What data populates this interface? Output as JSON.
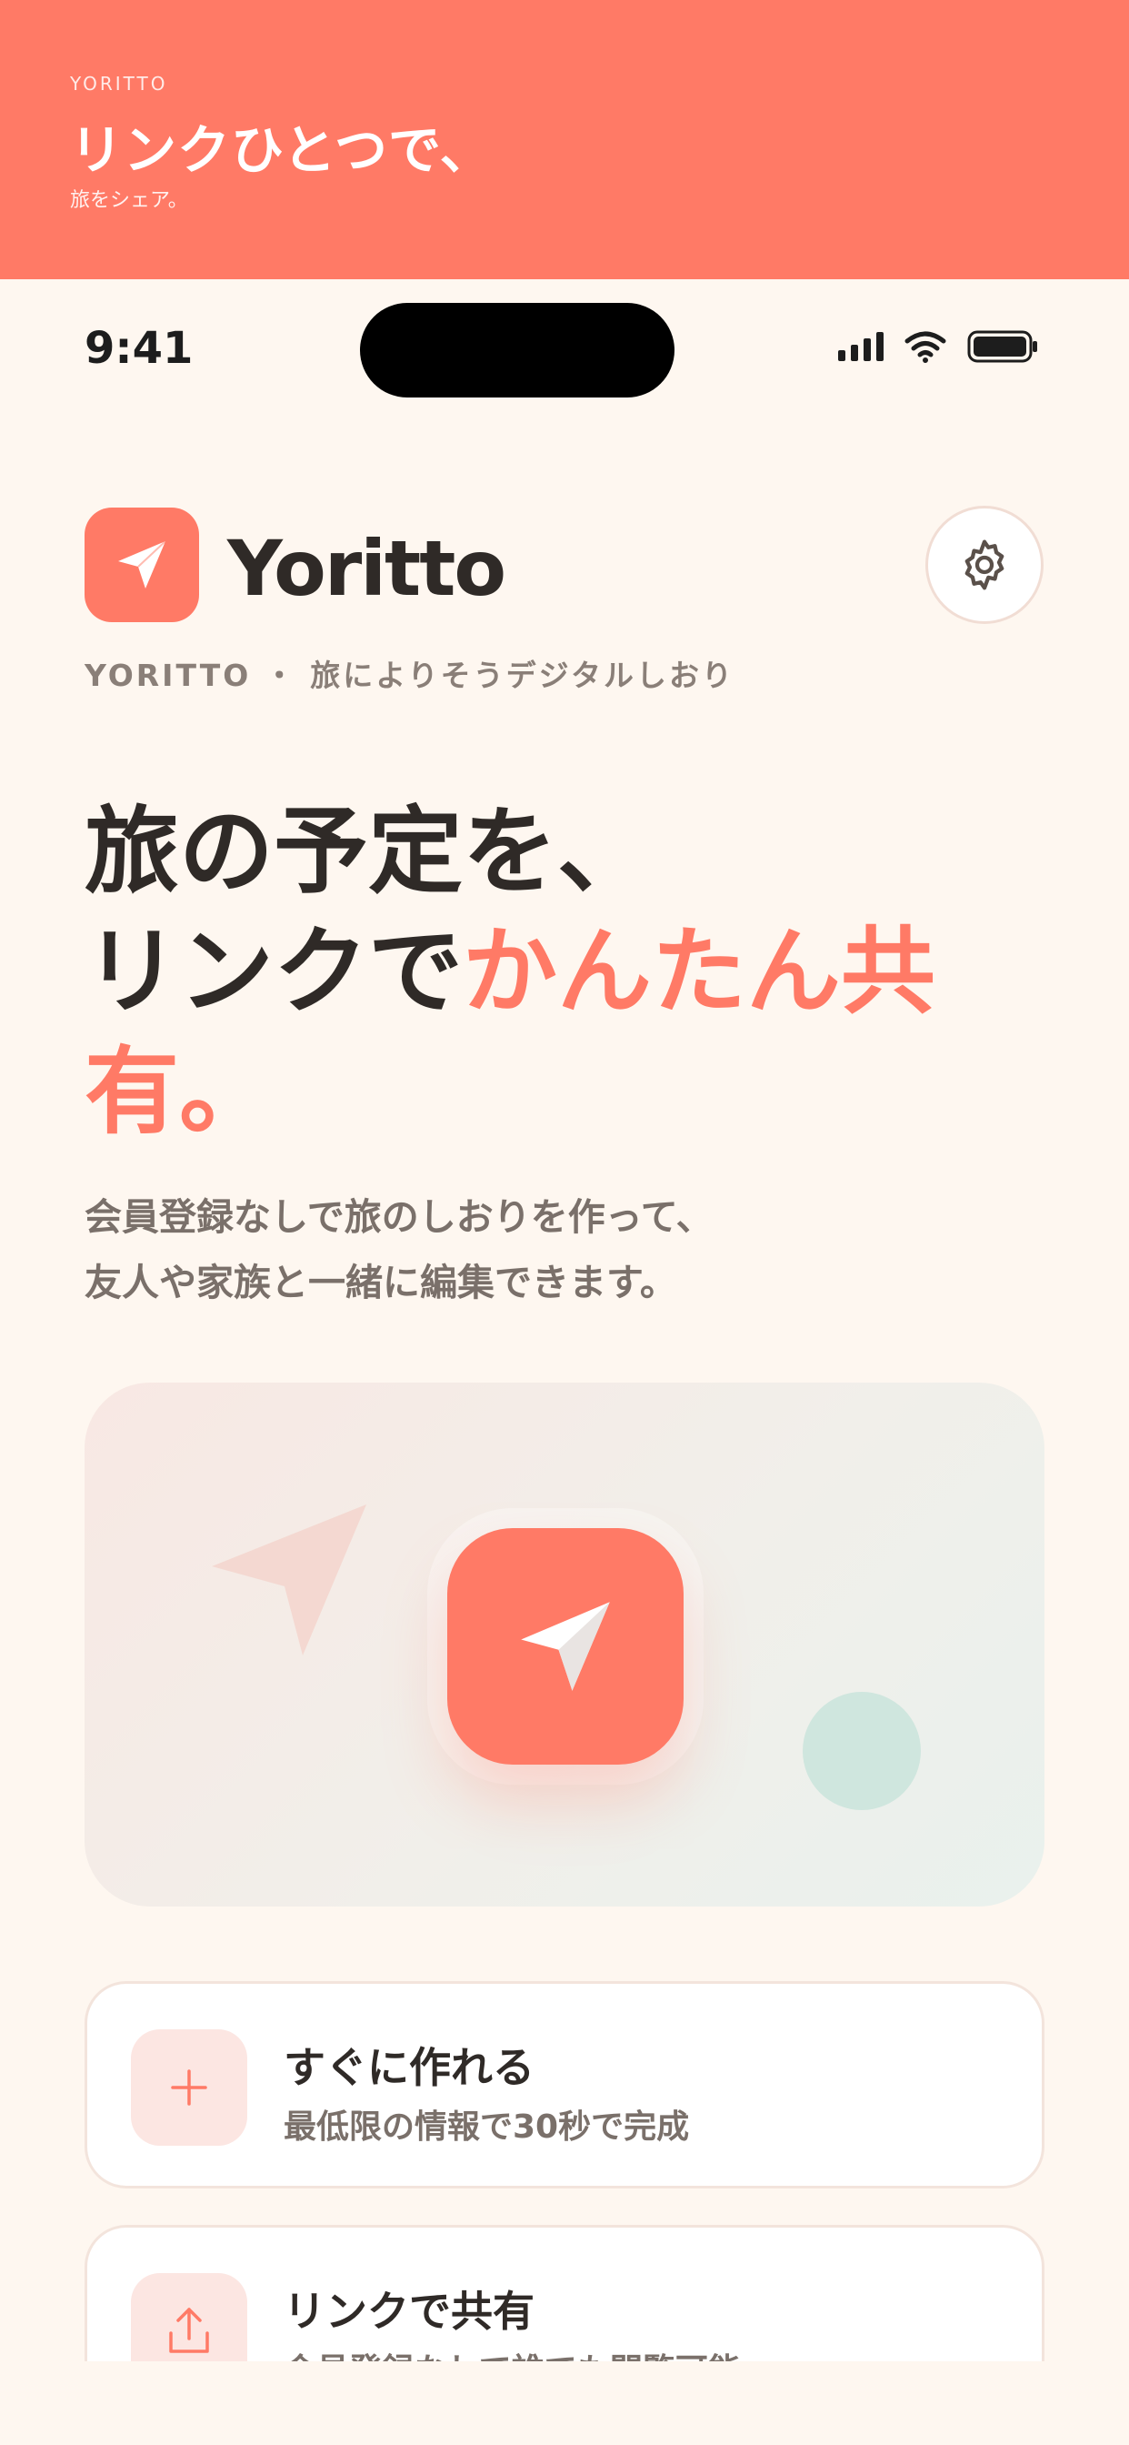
{
  "banner": {
    "eyebrow": "YORITTO",
    "headline": "リンクひとつで、",
    "sub": "旅をシェア。"
  },
  "status_bar": {
    "time": "9:41"
  },
  "header": {
    "app_name": "Yoritto",
    "tagline": "YORITTO ・ 旅によりそうデジタルしおり",
    "logo_icon": "paper-plane-icon",
    "settings_icon": "gear-icon"
  },
  "hero": {
    "title_line1": "旅の予定を、",
    "title_line2_plain": "リンクで",
    "title_line2_accent": "かんたん共有。",
    "desc_line1": "会員登録なしで旅のしおりを作って、",
    "desc_line2": "友人や家族と一緒に編集できます。"
  },
  "features": [
    {
      "icon": "plus-icon",
      "title": "すぐに作れる",
      "desc": "最低限の情報で30秒で完成"
    },
    {
      "icon": "share-icon",
      "title": "リンクで共有",
      "desc": "会員登録なしで誰でも閲覧可能"
    }
  ],
  "colors": {
    "accent": "#FF7A66",
    "background": "#FEF7F0",
    "text": "#2F2A27",
    "muted": "#7A706A",
    "mint": "#CFE6DE"
  }
}
